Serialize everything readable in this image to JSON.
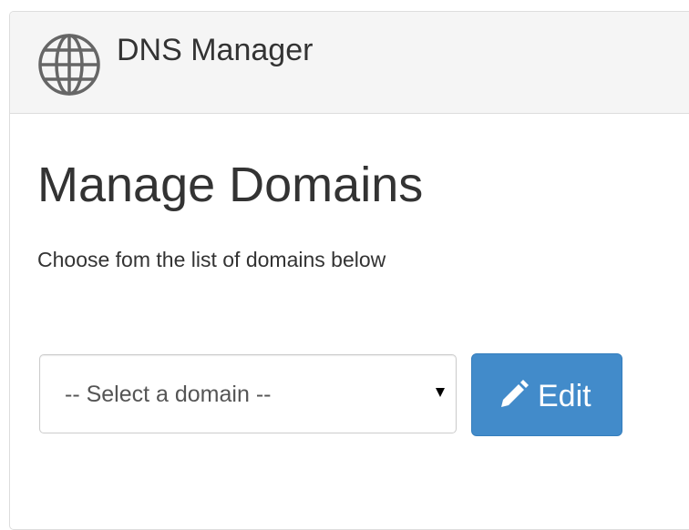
{
  "header": {
    "app_title": "DNS Manager",
    "icon": "globe-icon"
  },
  "main": {
    "title": "Manage Domains",
    "subtitle": "Choose fom the list of domains below",
    "domain_select": {
      "selected": "-- Select a domain --"
    },
    "edit_button": {
      "label": "Edit",
      "icon": "pencil-icon"
    }
  },
  "colors": {
    "heading_bg": "#f5f5f5",
    "border": "#dddddd",
    "primary": "#428bca",
    "text": "#333333",
    "icon": "#666666"
  }
}
